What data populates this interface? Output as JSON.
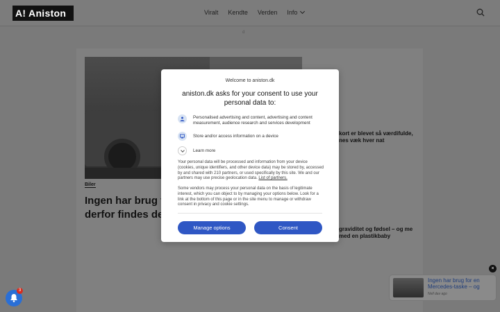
{
  "header": {
    "logo_text": "A! Aniston",
    "nav": [
      {
        "label": "Viralt"
      },
      {
        "label": "Kendte"
      },
      {
        "label": "Verden"
      },
      {
        "label": "Info"
      }
    ],
    "search_icon": "search-icon"
  },
  "ad_marker": "d",
  "article": {
    "category": "Biler",
    "headline": "Ingen har brug fo derfor findes der",
    "side_1": "kort er blevet så værdifulde, nes væk hver nat",
    "side_2": "graviditet og fødsel – og me med en plastikbaby"
  },
  "notification": {
    "count": "3",
    "icon": "bell-icon"
  },
  "promo": {
    "title": "Ingen har brug for en Mercedes-taske – og",
    "time": "Nell dav ago",
    "close": "×"
  },
  "consent": {
    "welcome": "Welcome to aniston.dk",
    "title": "aniston.dk asks for your consent to use your personal data to:",
    "items": [
      {
        "icon": "person-icon",
        "text": "Personalised advertising and content, advertising and content measurement, audience research and services development"
      },
      {
        "icon": "device-icon",
        "text": "Store and/or access information on a device"
      }
    ],
    "learn_more": "Learn more",
    "para1_text": "Your personal data will be processed and information from your device (cookies, unique identifiers, and other device data) may be stored by, accessed by and shared with 210 partners, or used specifically by this site. We and our partners may use precise geolocation data.",
    "para1_link": "List of partners.",
    "para2": "Some vendors may process your personal data on the basis of legitimate interest, which you can object to by managing your options below. Look for a link at the bottom of this page or in the site menu to manage or withdraw consent in privacy and cookie settings.",
    "manage_label": "Manage options",
    "consent_label": "Consent",
    "accent": "#2f57c4"
  }
}
